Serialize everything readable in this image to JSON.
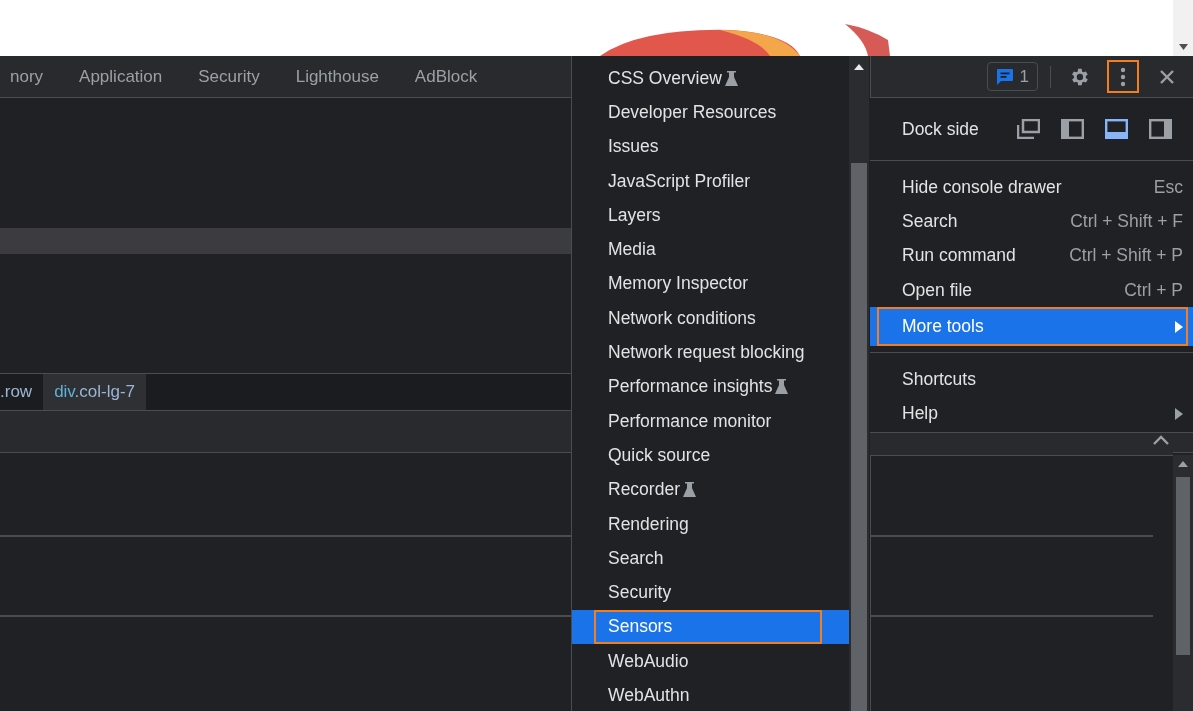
{
  "toolbar": {
    "tabs": [
      {
        "label": "nory",
        "selected": false
      },
      {
        "label": "Application",
        "selected": false
      },
      {
        "label": "Security",
        "selected": false
      },
      {
        "label": "Lighthouse",
        "selected": false
      },
      {
        "label": "AdBlock",
        "selected": false
      }
    ],
    "issues_count": "1",
    "more_button": {
      "highlighted": true
    }
  },
  "breadcrumbs": [
    {
      "cls": ".row",
      "selected": false
    },
    {
      "tag": "div",
      "cls": ".col-lg-7",
      "selected": true
    }
  ],
  "main_menu": {
    "dock_side": {
      "label": "Dock side",
      "options": [
        {
          "kind": "undock",
          "selected": false
        },
        {
          "kind": "left",
          "selected": false
        },
        {
          "kind": "bottom",
          "selected": true
        },
        {
          "kind": "right",
          "selected": false
        }
      ]
    },
    "sections": [
      {
        "items": [
          {
            "label": "Hide console drawer",
            "shortcut": "Esc",
            "submenu": false,
            "selected": false,
            "highlighted": false
          },
          {
            "label": "Search",
            "shortcut": "Ctrl + Shift + F",
            "submenu": false,
            "selected": false,
            "highlighted": false
          },
          {
            "label": "Run command",
            "shortcut": "Ctrl + Shift + P",
            "submenu": false,
            "selected": false,
            "highlighted": false
          },
          {
            "label": "Open file",
            "shortcut": "Ctrl + P",
            "submenu": false,
            "selected": false,
            "highlighted": false
          },
          {
            "label": "More tools",
            "submenu": true,
            "selected": true,
            "highlighted": true
          }
        ]
      },
      {
        "items": [
          {
            "label": "Shortcuts",
            "submenu": false,
            "selected": false,
            "highlighted": false
          },
          {
            "label": "Help",
            "submenu": true,
            "selected": false,
            "highlighted": false
          }
        ]
      }
    ]
  },
  "more_tools_menu": {
    "items": [
      {
        "label": "CSS Overview",
        "experimental": true,
        "selected": false,
        "highlighted": false
      },
      {
        "label": "Developer Resources",
        "experimental": false,
        "selected": false,
        "highlighted": false
      },
      {
        "label": "Issues",
        "experimental": false,
        "selected": false,
        "highlighted": false
      },
      {
        "label": "JavaScript Profiler",
        "experimental": false,
        "selected": false,
        "highlighted": false
      },
      {
        "label": "Layers",
        "experimental": false,
        "selected": false,
        "highlighted": false
      },
      {
        "label": "Media",
        "experimental": false,
        "selected": false,
        "highlighted": false
      },
      {
        "label": "Memory Inspector",
        "experimental": false,
        "selected": false,
        "highlighted": false
      },
      {
        "label": "Network conditions",
        "experimental": false,
        "selected": false,
        "highlighted": false
      },
      {
        "label": "Network request blocking",
        "experimental": false,
        "selected": false,
        "highlighted": false
      },
      {
        "label": "Performance insights",
        "experimental": true,
        "selected": false,
        "highlighted": false
      },
      {
        "label": "Performance monitor",
        "experimental": false,
        "selected": false,
        "highlighted": false
      },
      {
        "label": "Quick source",
        "experimental": false,
        "selected": false,
        "highlighted": false
      },
      {
        "label": "Recorder",
        "experimental": true,
        "selected": false,
        "highlighted": false
      },
      {
        "label": "Rendering",
        "experimental": false,
        "selected": false,
        "highlighted": false
      },
      {
        "label": "Search",
        "experimental": false,
        "selected": false,
        "highlighted": false
      },
      {
        "label": "Security",
        "experimental": false,
        "selected": false,
        "highlighted": false
      },
      {
        "label": "Sensors",
        "experimental": false,
        "selected": true,
        "highlighted": true
      },
      {
        "label": "WebAudio",
        "experimental": false,
        "selected": false,
        "highlighted": false
      },
      {
        "label": "WebAuthn",
        "experimental": false,
        "selected": false,
        "highlighted": false
      }
    ]
  }
}
